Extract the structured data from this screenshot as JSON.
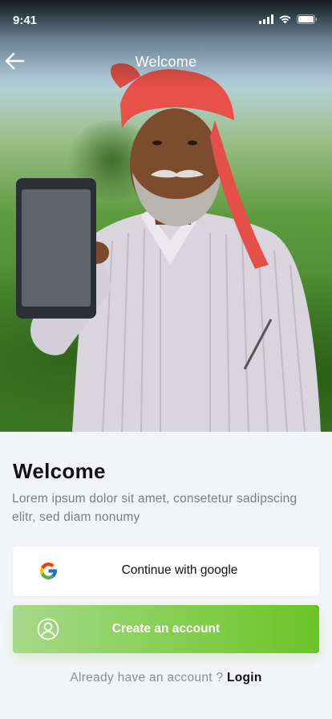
{
  "status_bar": {
    "time": "9:41"
  },
  "nav": {
    "title": "Welcome"
  },
  "content": {
    "heading": "Welcome",
    "description": "Lorem ipsum dolor sit amet, consetetur sadipscing elitr, sed diam nonumy"
  },
  "buttons": {
    "google_label": "Continue with google",
    "create_label": "Create an account"
  },
  "login": {
    "prompt": "Already have an account ?",
    "link": "Login"
  },
  "colors": {
    "accent": "#6cc427",
    "accent_light": "#a6d98a",
    "background": "#f3f4f8",
    "headband": "#e8514a"
  },
  "icons": {
    "back": "arrow-left-icon",
    "google": "google-g-icon",
    "user": "user-circle-icon",
    "signal": "cellular-signal-icon",
    "wifi": "wifi-icon",
    "battery": "battery-icon"
  }
}
